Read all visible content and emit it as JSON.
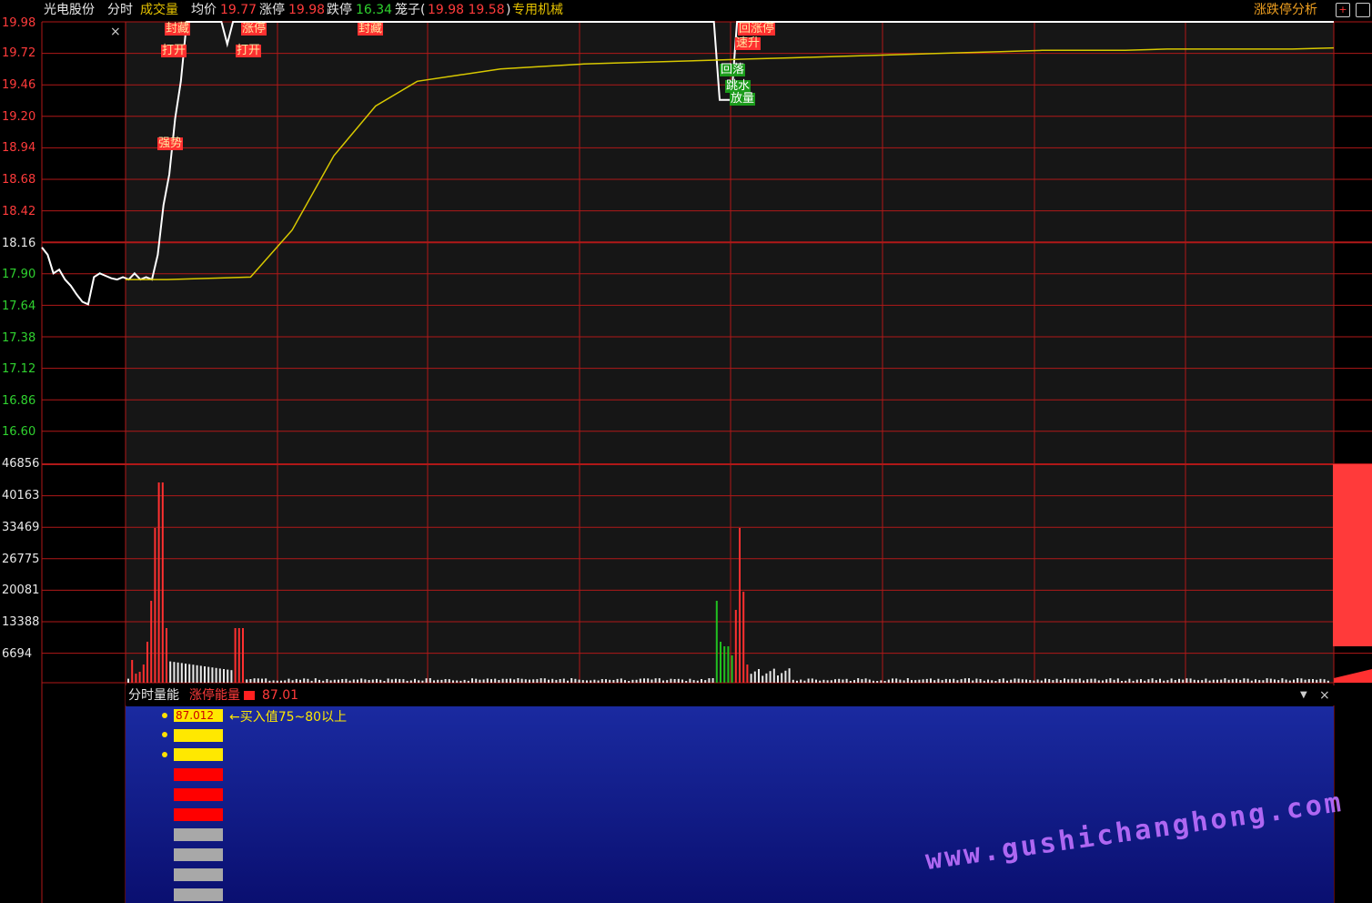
{
  "header": {
    "stock_name": "光电股份",
    "mode": "分时",
    "volume_label": "成交量",
    "avg_label": "均价",
    "avg_value": "19.77",
    "limit_up_label": "涨停",
    "limit_up_value": "19.98",
    "limit_down_label": "跌停",
    "limit_down_value": "16.34",
    "cage_label": "笼子(",
    "cage_value": "19.98 19.58",
    "cage_close": ")",
    "sector": "专用机械",
    "analysis_button": "涨跌停分析"
  },
  "price_axis": [
    "19.98",
    "19.72",
    "19.46",
    "19.20",
    "18.94",
    "18.68",
    "18.42",
    "18.16",
    "17.90",
    "17.64",
    "17.38",
    "17.12",
    "16.86",
    "16.60"
  ],
  "volume_axis": [
    "46856",
    "40163",
    "33469",
    "26775",
    "20081",
    "13388",
    "6694"
  ],
  "annotations": {
    "seal1": "封藏",
    "open1": "打开",
    "limit2": "涨停",
    "open2": "打开",
    "seal3": "封藏",
    "strong": "强势",
    "back_limit": "回涨停",
    "fast_up": "速升",
    "fall_back": "回落",
    "dive": "跳水",
    "vol_up": "放量"
  },
  "sub_panel": {
    "title": "分时量能",
    "indicator_label": "涨停能量",
    "indicator_value": "87.01",
    "bar_value": "87.012",
    "hint": "←买入值75~80以上"
  },
  "watermark": "www.gushichanghong.com",
  "colors": {
    "grid": "#b01818",
    "price_line": "#ffffff",
    "avg_line": "#d8c800",
    "up": "#ff3030",
    "down": "#20c020",
    "panel": "#0f1a90"
  },
  "chart_data": {
    "type": "line",
    "ylim": [
      16.6,
      19.98
    ],
    "series": [
      {
        "values": [
          18.16,
          18.1,
          17.95,
          17.98,
          17.9,
          17.85,
          17.78,
          17.72,
          17.7,
          17.92,
          17.95,
          17.93,
          17.91,
          17.9,
          17.92,
          17.9,
          17.95,
          17.9,
          17.92,
          17.9,
          18.1,
          18.5,
          18.75,
          19.2,
          19.5,
          19.98,
          19.98,
          19.98,
          19.98,
          19.98,
          19.98,
          19.98,
          19.8,
          19.98,
          19.98,
          19.98,
          19.98,
          19.98,
          19.98,
          19.98,
          19.98,
          19.98,
          19.98,
          19.98,
          19.98,
          19.98,
          19.98,
          19.98,
          19.98,
          19.98,
          19.98,
          19.98,
          19.98,
          19.98,
          19.98,
          19.98,
          19.98,
          19.98,
          19.98,
          19.98,
          19.98,
          19.98,
          19.98,
          19.98,
          19.98,
          19.98,
          19.98,
          19.98,
          19.98,
          19.98,
          19.98,
          19.98,
          19.98,
          19.98,
          19.98,
          19.98,
          19.98,
          19.98,
          19.98,
          19.98,
          19.98,
          19.98,
          19.98,
          19.98,
          19.98,
          19.98,
          19.98,
          19.98,
          19.98,
          19.98,
          19.98,
          19.98,
          19.98,
          19.98,
          19.98,
          19.98,
          19.98,
          19.98,
          19.98,
          19.98,
          19.98,
          19.98,
          19.98,
          19.98,
          19.98,
          19.98,
          19.98,
          19.98,
          19.98,
          19.98,
          19.98,
          19.98,
          19.98,
          19.98,
          19.98,
          19.98,
          19.98,
          19.98,
          19.98,
          19.98,
          19.98,
          19.98,
          19.98,
          19.98,
          19.98,
          19.98,
          19.98,
          19.98,
          19.98,
          19.98,
          19.98,
          19.98,
          19.98,
          19.98,
          19.98,
          19.98,
          19.98,
          19.98,
          19.98,
          19.98,
          19.98,
          19.98,
          19.98,
          19.98,
          19.98,
          19.98,
          19.98,
          19.98,
          19.98,
          19.98,
          19.98,
          19.98,
          19.98,
          19.98,
          19.98,
          19.98,
          19.98,
          19.98,
          19.98,
          19.98,
          19.98,
          19.98,
          19.98,
          19.98,
          19.98,
          19.98,
          19.98,
          19.98,
          19.98,
          19.98,
          19.98,
          19.98,
          19.98,
          19.98,
          19.98,
          19.98,
          19.98,
          19.98,
          19.98,
          19.98,
          19.98,
          19.98,
          19.98,
          19.98,
          19.98,
          19.98,
          19.98,
          19.98,
          19.98,
          19.98,
          19.98,
          19.98,
          19.98,
          19.98,
          19.98,
          19.98,
          19.98,
          19.98,
          19.98,
          19.98,
          19.98,
          19.98,
          19.98,
          19.98,
          19.98,
          19.98,
          19.98,
          19.98,
          19.98,
          19.98,
          19.98,
          19.98,
          19.98,
          19.98,
          19.98,
          19.98,
          19.98,
          19.98,
          19.98,
          19.98,
          19.98,
          19.98,
          19.98,
          19.98
        ]
      },
      {
        "values": [
          17.9,
          17.9,
          17.91,
          17.92,
          18.3,
          18.9,
          19.3,
          19.5,
          19.55,
          19.6,
          19.62,
          19.64,
          19.65,
          19.66,
          19.67,
          19.68,
          19.69,
          19.7,
          19.71,
          19.72,
          19.73,
          19.74,
          19.75,
          19.75,
          19.75,
          19.76,
          19.76,
          19.76,
          19.76,
          19.77
        ]
      }
    ]
  }
}
